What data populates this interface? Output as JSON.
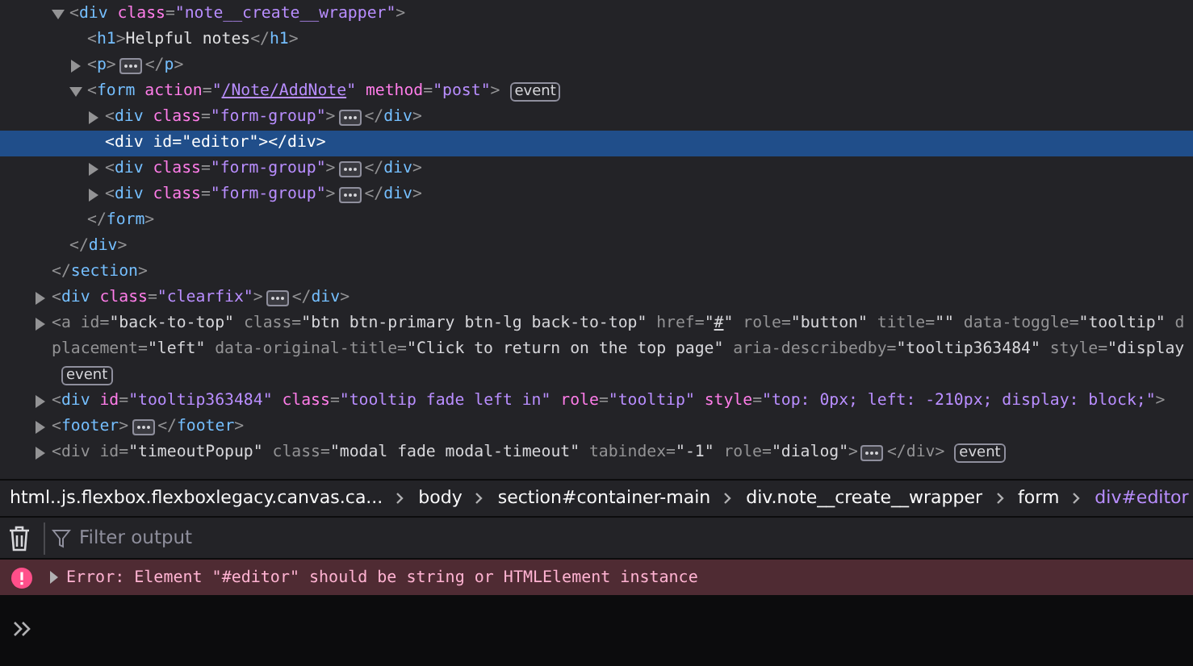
{
  "markup": {
    "nodes": [
      {
        "children": [
          {
            "expanded": true,
            "selected": false,
            "dimmed": false,
            "lines": [
              [
                {
                  "kind": "punct",
                  "text": "<"
                },
                {
                  "kind": "tag",
                  "text": "div"
                },
                {
                  "kind": "attr",
                  "text": " class"
                },
                {
                  "kind": "punct",
                  "text": "="
                },
                {
                  "kind": "value",
                  "text": "\"note__create__wrapper\""
                },
                {
                  "kind": "punct",
                  "text": ">"
                }
              ]
            ],
            "children": [
              {
                "selected": false,
                "dimmed": false,
                "lines": [
                  [
                    {
                      "kind": "punct",
                      "text": "<"
                    },
                    {
                      "kind": "tag",
                      "text": "h1"
                    },
                    {
                      "kind": "punct",
                      "text": ">"
                    },
                    {
                      "kind": "text",
                      "text": "Helpful notes"
                    },
                    {
                      "kind": "punct",
                      "text": "</"
                    },
                    {
                      "kind": "tag",
                      "text": "h1"
                    },
                    {
                      "kind": "punct",
                      "text": ">"
                    }
                  ]
                ]
              },
              {
                "expanded": false,
                "selected": false,
                "dimmed": false,
                "lines": [
                  [
                    {
                      "kind": "punct",
                      "text": "<"
                    },
                    {
                      "kind": "tag",
                      "text": "p"
                    },
                    {
                      "kind": "punct",
                      "text": ">"
                    },
                    {
                      "kind": "more"
                    },
                    {
                      "kind": "punct",
                      "text": "</"
                    },
                    {
                      "kind": "tag",
                      "text": "p"
                    },
                    {
                      "kind": "punct",
                      "text": ">"
                    }
                  ]
                ]
              },
              {
                "expanded": true,
                "selected": false,
                "dimmed": false,
                "lines": [
                  [
                    {
                      "kind": "punct",
                      "text": "<"
                    },
                    {
                      "kind": "tag",
                      "text": "form"
                    },
                    {
                      "kind": "attr",
                      "text": " action"
                    },
                    {
                      "kind": "punct",
                      "text": "="
                    },
                    {
                      "kind": "value",
                      "text": "\""
                    },
                    {
                      "kind": "link",
                      "text": "/Note/AddNote"
                    },
                    {
                      "kind": "value",
                      "text": "\""
                    },
                    {
                      "kind": "attr",
                      "text": " method"
                    },
                    {
                      "kind": "punct",
                      "text": "="
                    },
                    {
                      "kind": "value",
                      "text": "\"post\""
                    },
                    {
                      "kind": "punct",
                      "text": ">"
                    },
                    {
                      "kind": "event",
                      "text": "event"
                    }
                  ]
                ],
                "children": [
                  {
                    "expanded": false,
                    "selected": false,
                    "dimmed": false,
                    "lines": [
                      [
                        {
                          "kind": "punct",
                          "text": "<"
                        },
                        {
                          "kind": "tag",
                          "text": "div"
                        },
                        {
                          "kind": "attr",
                          "text": " class"
                        },
                        {
                          "kind": "punct",
                          "text": "="
                        },
                        {
                          "kind": "value",
                          "text": "\"form-group\""
                        },
                        {
                          "kind": "punct",
                          "text": ">"
                        },
                        {
                          "kind": "more"
                        },
                        {
                          "kind": "punct",
                          "text": "</"
                        },
                        {
                          "kind": "tag",
                          "text": "div"
                        },
                        {
                          "kind": "punct",
                          "text": ">"
                        }
                      ]
                    ]
                  },
                  {
                    "selected": true,
                    "dimmed": false,
                    "lines": [
                      [
                        {
                          "kind": "punct",
                          "text": "<"
                        },
                        {
                          "kind": "tag",
                          "text": "div"
                        },
                        {
                          "kind": "attr",
                          "text": " id"
                        },
                        {
                          "kind": "punct",
                          "text": "="
                        },
                        {
                          "kind": "value",
                          "text": "\"editor\""
                        },
                        {
                          "kind": "punct",
                          "text": "></"
                        },
                        {
                          "kind": "tag",
                          "text": "div"
                        },
                        {
                          "kind": "punct",
                          "text": ">"
                        }
                      ]
                    ]
                  },
                  {
                    "expanded": false,
                    "selected": false,
                    "dimmed": false,
                    "lines": [
                      [
                        {
                          "kind": "punct",
                          "text": "<"
                        },
                        {
                          "kind": "tag",
                          "text": "div"
                        },
                        {
                          "kind": "attr",
                          "text": " class"
                        },
                        {
                          "kind": "punct",
                          "text": "="
                        },
                        {
                          "kind": "value",
                          "text": "\"form-group\""
                        },
                        {
                          "kind": "punct",
                          "text": ">"
                        },
                        {
                          "kind": "more"
                        },
                        {
                          "kind": "punct",
                          "text": "</"
                        },
                        {
                          "kind": "tag",
                          "text": "div"
                        },
                        {
                          "kind": "punct",
                          "text": ">"
                        }
                      ]
                    ]
                  },
                  {
                    "expanded": false,
                    "selected": false,
                    "dimmed": false,
                    "lines": [
                      [
                        {
                          "kind": "punct",
                          "text": "<"
                        },
                        {
                          "kind": "tag",
                          "text": "div"
                        },
                        {
                          "kind": "attr",
                          "text": " class"
                        },
                        {
                          "kind": "punct",
                          "text": "="
                        },
                        {
                          "kind": "value",
                          "text": "\"form-group\""
                        },
                        {
                          "kind": "punct",
                          "text": ">"
                        },
                        {
                          "kind": "more"
                        },
                        {
                          "kind": "punct",
                          "text": "</"
                        },
                        {
                          "kind": "tag",
                          "text": "div"
                        },
                        {
                          "kind": "punct",
                          "text": ">"
                        }
                      ]
                    ]
                  }
                ],
                "closing": [
                  {
                    "kind": "punct",
                    "text": "</"
                  },
                  {
                    "kind": "tag",
                    "text": "form"
                  },
                  {
                    "kind": "punct",
                    "text": ">"
                  }
                ]
              }
            ],
            "closing": [
              {
                "kind": "punct",
                "text": "</"
              },
              {
                "kind": "tag",
                "text": "div"
              },
              {
                "kind": "punct",
                "text": ">"
              }
            ]
          }
        ],
        "closing": [
          {
            "kind": "punct",
            "text": "</"
          },
          {
            "kind": "tag",
            "text": "section"
          },
          {
            "kind": "punct",
            "text": ">"
          }
        ]
      },
      {
        "expanded": false,
        "selected": false,
        "dimmed": false,
        "lines": [
          [
            {
              "kind": "punct",
              "text": "<"
            },
            {
              "kind": "tag",
              "text": "div"
            },
            {
              "kind": "attr",
              "text": " class"
            },
            {
              "kind": "punct",
              "text": "="
            },
            {
              "kind": "value",
              "text": "\"clearfix\""
            },
            {
              "kind": "punct",
              "text": ">"
            },
            {
              "kind": "more"
            },
            {
              "kind": "punct",
              "text": "</"
            },
            {
              "kind": "tag",
              "text": "div"
            },
            {
              "kind": "punct",
              "text": ">"
            }
          ]
        ]
      },
      {
        "expanded": false,
        "selected": false,
        "dimmed": true,
        "lines": [
          [
            {
              "kind": "punct",
              "text": "<"
            },
            {
              "kind": "tag",
              "text": "a"
            },
            {
              "kind": "attr",
              "text": " id"
            },
            {
              "kind": "punct",
              "text": "="
            },
            {
              "kind": "value",
              "text": "\"back-to-top\""
            },
            {
              "kind": "attr",
              "text": " class"
            },
            {
              "kind": "punct",
              "text": "="
            },
            {
              "kind": "value",
              "text": "\"btn btn-primary btn-lg back-to-top\""
            },
            {
              "kind": "attr",
              "text": " href"
            },
            {
              "kind": "punct",
              "text": "="
            },
            {
              "kind": "value",
              "text": "\""
            },
            {
              "kind": "link",
              "text": "#"
            },
            {
              "kind": "value",
              "text": "\""
            },
            {
              "kind": "attr",
              "text": " role"
            },
            {
              "kind": "punct",
              "text": "="
            },
            {
              "kind": "value",
              "text": "\"button\""
            },
            {
              "kind": "attr",
              "text": " title"
            },
            {
              "kind": "punct",
              "text": "="
            },
            {
              "kind": "value",
              "text": "\"\""
            },
            {
              "kind": "attr",
              "text": " data-toggle"
            },
            {
              "kind": "punct",
              "text": "="
            },
            {
              "kind": "value",
              "text": "\"tooltip\""
            },
            {
              "kind": "attr",
              "text": " d"
            }
          ],
          [
            {
              "kind": "attr",
              "text": "placement"
            },
            {
              "kind": "punct",
              "text": "="
            },
            {
              "kind": "value",
              "text": "\"left\""
            },
            {
              "kind": "attr",
              "text": " data-original-title"
            },
            {
              "kind": "punct",
              "text": "="
            },
            {
              "kind": "value",
              "text": "\"Click to return on the top page\""
            },
            {
              "kind": "attr",
              "text": " aria-describedby"
            },
            {
              "kind": "punct",
              "text": "="
            },
            {
              "kind": "value",
              "text": "\"tooltip363484\""
            },
            {
              "kind": "attr",
              "text": " style"
            },
            {
              "kind": "punct",
              "text": "="
            },
            {
              "kind": "value",
              "text": "\"display"
            }
          ],
          [
            {
              "kind": "event",
              "text": "event"
            }
          ]
        ]
      },
      {
        "expanded": false,
        "selected": false,
        "dimmed": false,
        "lines": [
          [
            {
              "kind": "punct",
              "text": "<"
            },
            {
              "kind": "tag",
              "text": "div"
            },
            {
              "kind": "attr",
              "text": " id"
            },
            {
              "kind": "punct",
              "text": "="
            },
            {
              "kind": "value",
              "text": "\"tooltip363484\""
            },
            {
              "kind": "attr",
              "text": " class"
            },
            {
              "kind": "punct",
              "text": "="
            },
            {
              "kind": "value",
              "text": "\"tooltip fade left in\""
            },
            {
              "kind": "attr",
              "text": " role"
            },
            {
              "kind": "punct",
              "text": "="
            },
            {
              "kind": "value",
              "text": "\"tooltip\""
            },
            {
              "kind": "attr",
              "text": " style"
            },
            {
              "kind": "punct",
              "text": "="
            },
            {
              "kind": "value",
              "text": "\"top: 0px; left: -210px; display: block;\""
            },
            {
              "kind": "punct",
              "text": ">"
            }
          ]
        ]
      },
      {
        "expanded": false,
        "selected": false,
        "dimmed": false,
        "lines": [
          [
            {
              "kind": "punct",
              "text": "<"
            },
            {
              "kind": "tag",
              "text": "footer"
            },
            {
              "kind": "punct",
              "text": ">"
            },
            {
              "kind": "more"
            },
            {
              "kind": "punct",
              "text": "</"
            },
            {
              "kind": "tag",
              "text": "footer"
            },
            {
              "kind": "punct",
              "text": ">"
            }
          ]
        ]
      },
      {
        "expanded": false,
        "selected": false,
        "dimmed": true,
        "lines": [
          [
            {
              "kind": "punct",
              "text": "<"
            },
            {
              "kind": "tag",
              "text": "div"
            },
            {
              "kind": "attr",
              "text": " id"
            },
            {
              "kind": "punct",
              "text": "="
            },
            {
              "kind": "value",
              "text": "\"timeoutPopup\""
            },
            {
              "kind": "attr",
              "text": " class"
            },
            {
              "kind": "punct",
              "text": "="
            },
            {
              "kind": "value",
              "text": "\"modal fade modal-timeout\""
            },
            {
              "kind": "attr",
              "text": " tabindex"
            },
            {
              "kind": "punct",
              "text": "="
            },
            {
              "kind": "value",
              "text": "\"-1\""
            },
            {
              "kind": "attr",
              "text": " role"
            },
            {
              "kind": "punct",
              "text": "="
            },
            {
              "kind": "value",
              "text": "\"dialog\""
            },
            {
              "kind": "punct",
              "text": ">"
            },
            {
              "kind": "more"
            },
            {
              "kind": "punct",
              "text": "</"
            },
            {
              "kind": "tag",
              "text": "div"
            },
            {
              "kind": "punct",
              "text": ">"
            },
            {
              "kind": "event",
              "text": "event"
            }
          ]
        ]
      }
    ]
  },
  "breadcrumbs": [
    {
      "text": "html..js.flexbox.flexboxlegacy.canvas.ca...",
      "selected": false
    },
    {
      "text": "body",
      "selected": false
    },
    {
      "text": "section#container-main",
      "selected": false
    },
    {
      "text": "div.note__create__wrapper",
      "selected": false
    },
    {
      "text": "form",
      "selected": false
    },
    {
      "text": "div#editor",
      "selected": true
    }
  ],
  "console": {
    "filter": {
      "placeholder": "Filter output"
    },
    "messages": [
      {
        "kind": "error",
        "expanded": false,
        "text": "Error: Element \"#editor\" should be string or HTMLElement instance"
      }
    ]
  }
}
